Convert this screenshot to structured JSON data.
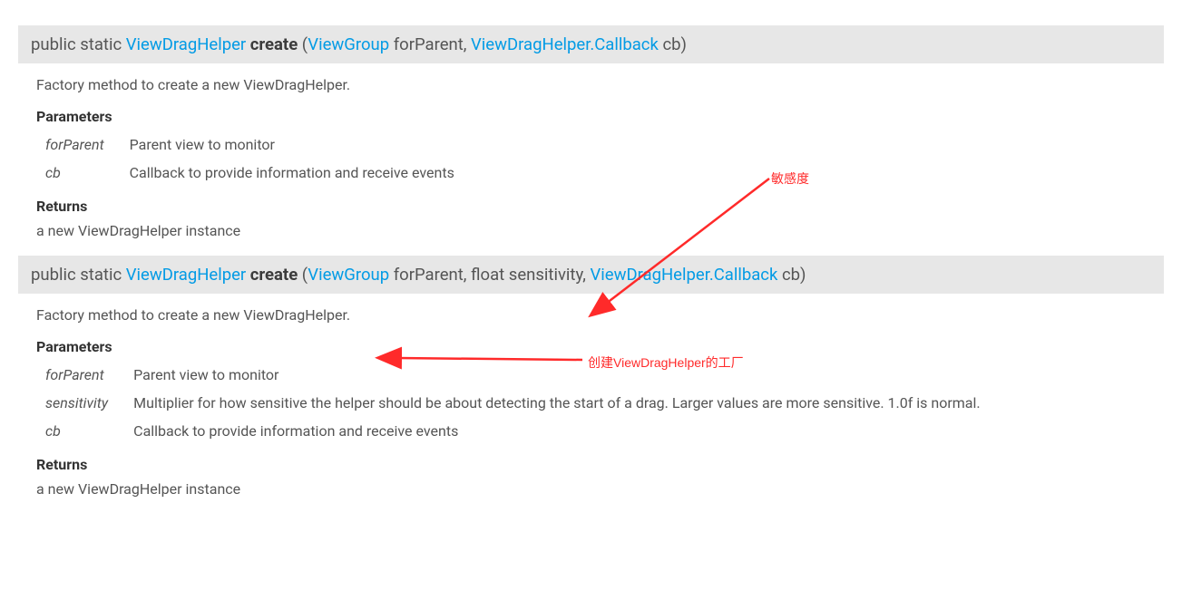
{
  "colors": {
    "link": "#039be5",
    "sigBg": "#e7e7e7",
    "anno": "#ff2a2a"
  },
  "method1": {
    "modifiers": "public static ",
    "returnType": "ViewDragHelper",
    "name": "create",
    "params": [
      {
        "type": "ViewGroup",
        "name": "forParent",
        "isLink": true
      },
      {
        "type": "ViewDragHelper.Callback",
        "name": "cb",
        "isLink": true
      }
    ],
    "description": "Factory method to create a new ViewDragHelper.",
    "paramsHeader": "Parameters",
    "paramDocs": [
      {
        "name": "forParent",
        "desc": "Parent view to monitor"
      },
      {
        "name": "cb",
        "desc": "Callback to provide information and receive events"
      }
    ],
    "returnsHeader": "Returns",
    "returnsText": "a new ViewDragHelper instance"
  },
  "method2": {
    "modifiers": "public static ",
    "returnType": "ViewDragHelper",
    "name": "create",
    "params": [
      {
        "type": "ViewGroup",
        "name": "forParent",
        "isLink": true
      },
      {
        "type": "float",
        "name": "sensitivity",
        "isLink": false
      },
      {
        "type": "ViewDragHelper.Callback",
        "name": "cb",
        "isLink": true
      }
    ],
    "description": "Factory method to create a new ViewDragHelper.",
    "paramsHeader": "Parameters",
    "paramDocs": [
      {
        "name": "forParent",
        "desc": "Parent view to monitor"
      },
      {
        "name": "sensitivity",
        "desc": "Multiplier for how sensitive the helper should be about detecting the start of a drag. Larger values are more sensitive. 1.0f is normal."
      },
      {
        "name": "cb",
        "desc": "Callback to provide information and receive events"
      }
    ],
    "returnsHeader": "Returns",
    "returnsText": "a new ViewDragHelper instance"
  },
  "annotations": {
    "a1": "敏感度",
    "a2": "创建ViewDragHelper的工厂"
  }
}
